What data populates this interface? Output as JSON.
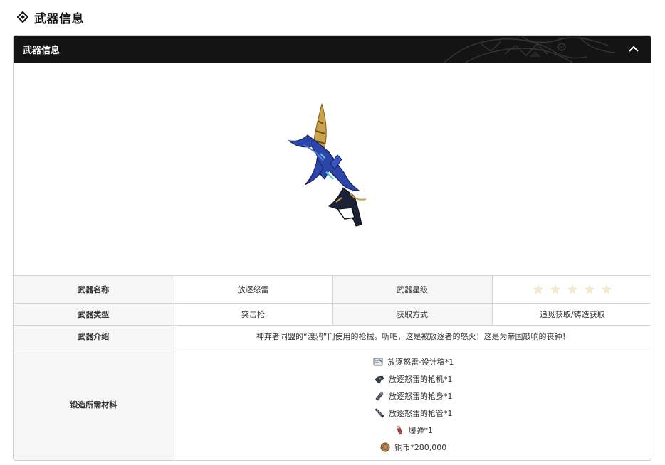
{
  "page": {
    "heading": "武器信息"
  },
  "panel": {
    "title": "武器信息"
  },
  "colors": {
    "header_bg": "#141414",
    "label_bg": "#f6f6f7",
    "border": "#d4d4d4",
    "weapon_blue": "#2b45a8",
    "weapon_gold": "#c9a24a"
  },
  "table": {
    "name_label": "武器名称",
    "name_value": "放逐怒雷",
    "rarity_label": "武器星级",
    "rarity_value": 5,
    "type_label": "武器类型",
    "type_value": "突击枪",
    "obtain_label": "获取方式",
    "obtain_value": "追觅获取/铸造获取",
    "intro_label": "武器介绍",
    "intro_value": "神弃者同盟的“渡鸦”们使用的枪械。听吧，这是被放逐者的怒火！这是为帝国敲响的丧钟！",
    "materials_label": "锻造所需材料"
  },
  "materials": [
    {
      "icon": "blueprint-icon",
      "text": "放逐怒雷·设计稿*1"
    },
    {
      "icon": "gun-receiver-icon",
      "text": "放逐怒雷的枪机*1"
    },
    {
      "icon": "gun-body-icon",
      "text": "放逐怒雷的枪身*1"
    },
    {
      "icon": "gun-barrel-icon",
      "text": "放逐怒雷的枪管*1"
    },
    {
      "icon": "cartridge-icon",
      "text": "爆弹*1"
    },
    {
      "icon": "copper-coin-icon",
      "text": "铜币*280,000"
    }
  ]
}
